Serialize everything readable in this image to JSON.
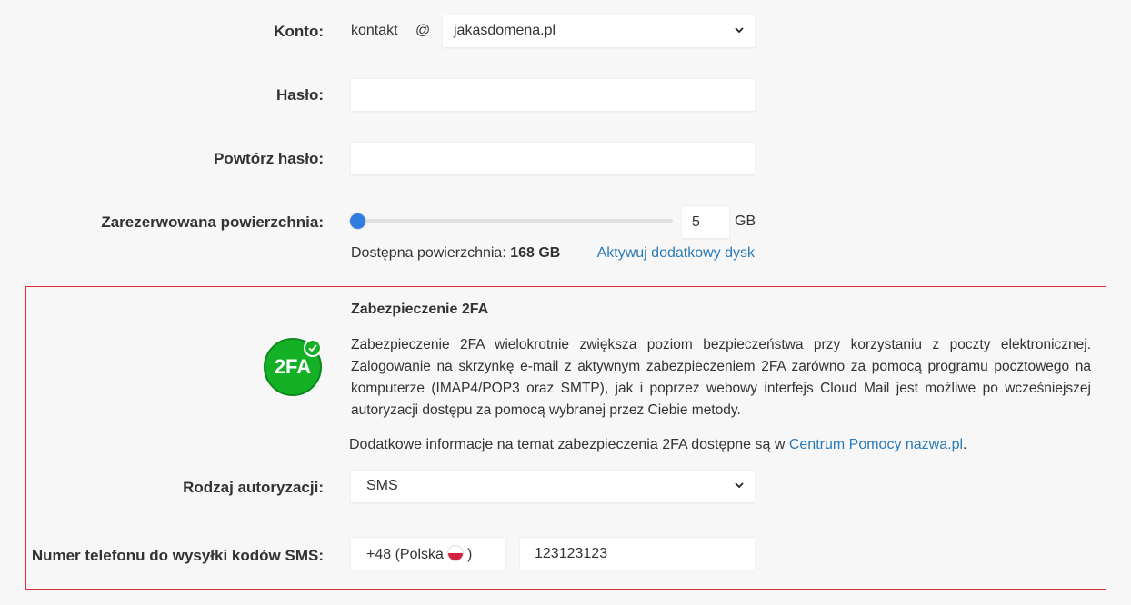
{
  "account": {
    "label": "Konto:",
    "local": "kontakt",
    "at": "@",
    "domain": "jakasdomena.pl"
  },
  "password": {
    "label": "Hasło:",
    "value": ""
  },
  "repeat_password": {
    "label": "Powtórz hasło:",
    "value": ""
  },
  "storage": {
    "label": "Zarezerwowana powierzchnia:",
    "value": "5",
    "unit": "GB",
    "slider_fraction": 0.0,
    "available_label": "Dostępna powierzchnia:",
    "available_value": "168 GB",
    "activate_link": "Aktywuj dodatkowy dysk"
  },
  "twofa": {
    "title": "Zabezpieczenie 2FA",
    "badge_text": "2FA",
    "description": "Zabezpieczenie 2FA wielokrotnie zwiększa poziom bezpieczeństwa przy korzystaniu z poczty elektronicznej. Zalogowanie na skrzynkę e-mail z aktywnym zabezpieczeniem 2FA zarówno za pomocą programu pocztowego na komputerze (IMAP4/POP3 oraz SMTP), jak i poprzez webowy interfejs Cloud Mail jest możliwe po wcześniejszej autoryzacji dostępu za pomocą wybranej przez Ciebie metody.",
    "info_prefix": "Dodatkowe informacje na temat zabezpieczenia 2FA dostępne są w",
    "info_link": "Centrum Pomocy nazwa.pl",
    "info_suffix": ".",
    "auth_label": "Rodzaj autoryzacji:",
    "auth_value": "SMS",
    "phone_label": "Numer telefonu do wysyłki kodów SMS:",
    "country_prefix": "+48 (Polska",
    "country_suffix": ")",
    "phone_value": "123123123",
    "colors": {
      "border": "#d9303a",
      "badge": "#14b026",
      "link": "#2a7ab8"
    }
  }
}
